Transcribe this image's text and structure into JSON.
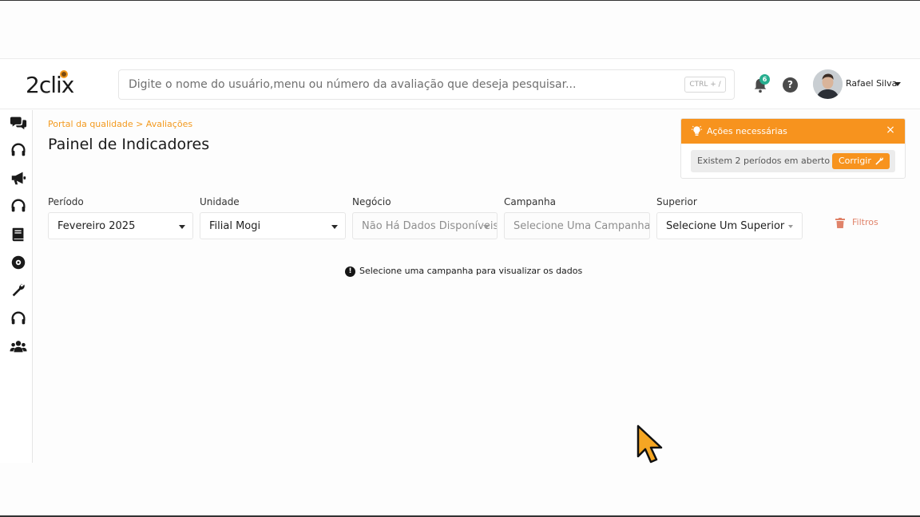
{
  "app": {
    "logo_text": "2clix"
  },
  "header": {
    "search_placeholder": "Digite o nome do usuário,menu ou número da avaliação que deseja pesquisar...",
    "search_shortcut": "CTRL + /",
    "notifications_count": "6",
    "help_label": "?",
    "user_name": "Rafael Silva"
  },
  "sidebar": {
    "items": [
      {
        "icon": "comments-icon"
      },
      {
        "icon": "headset-icon"
      },
      {
        "icon": "megaphone-icon"
      },
      {
        "icon": "headset-icon"
      },
      {
        "icon": "book-icon"
      },
      {
        "icon": "brain-gear-icon"
      },
      {
        "icon": "wrench-icon"
      },
      {
        "icon": "headset-icon"
      },
      {
        "icon": "users-icon"
      }
    ]
  },
  "page": {
    "breadcrumb": "Portal da qualidade > Avaliações",
    "title": "Painel de Indicadores"
  },
  "filters": {
    "periodo": {
      "label": "Período",
      "value": "Fevereiro 2025"
    },
    "unidade": {
      "label": "Unidade",
      "value": "Filial Mogi"
    },
    "negocio": {
      "label": "Negócio",
      "value": "Não Há Dados Disponíveis"
    },
    "campanha": {
      "label": "Campanha",
      "value": "Selecione Uma Campanha"
    },
    "superior": {
      "label": "Superior",
      "value": "Selecione Um Superior"
    },
    "clear_label": "Filtros"
  },
  "info": {
    "message": "Selecione uma campanha para visualizar os dados"
  },
  "actions_panel": {
    "title": "Ações necessárias",
    "close": "×",
    "message": "Existem 2 períodos em aberto",
    "fix_label": "Corrigir"
  },
  "colors": {
    "accent": "#f7931e",
    "badge": "#27ae8f",
    "breadcrumb": "#f39a1f"
  }
}
